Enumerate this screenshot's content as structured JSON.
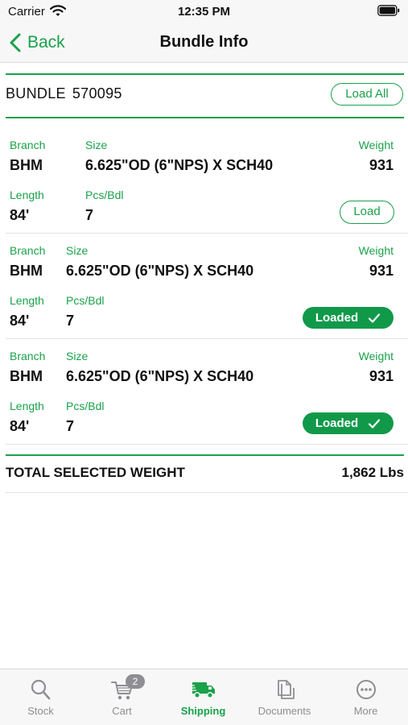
{
  "status_bar": {
    "carrier": "Carrier",
    "time": "12:35 PM"
  },
  "nav": {
    "back_label": "Back",
    "title": "Bundle Info"
  },
  "bundle": {
    "label": "BUNDLE",
    "number": "570095",
    "load_all_label": "Load All"
  },
  "labels": {
    "branch": "Branch",
    "size": "Size",
    "weight": "Weight",
    "length": "Length",
    "pcs_bdl": "Pcs/Bdl"
  },
  "items": [
    {
      "branch": "BHM",
      "size": "6.625\"OD (6\"NPS) X SCH40",
      "weight": "931",
      "length": "84'",
      "pcs_bdl": "7",
      "action_label": "Load",
      "state": "not-loaded"
    },
    {
      "branch": "BHM",
      "size": "6.625\"OD (6\"NPS) X SCH40",
      "weight": "931",
      "length": "84'",
      "pcs_bdl": "7",
      "action_label": "Loaded",
      "state": "loaded"
    },
    {
      "branch": "BHM",
      "size": "6.625\"OD (6\"NPS) X SCH40",
      "weight": "931",
      "length": "84'",
      "pcs_bdl": "7",
      "action_label": "Loaded",
      "state": "loaded"
    }
  ],
  "total": {
    "label": "TOTAL SELECTED WEIGHT",
    "value": "1,862 Lbs"
  },
  "tabs": [
    {
      "label": "Stock",
      "icon": "search-icon",
      "active": false
    },
    {
      "label": "Cart",
      "icon": "cart-icon",
      "active": false,
      "badge": "2"
    },
    {
      "label": "Shipping",
      "icon": "truck-icon",
      "active": true
    },
    {
      "label": "Documents",
      "icon": "documents-icon",
      "active": false
    },
    {
      "label": "More",
      "icon": "more-icon",
      "active": false
    }
  ],
  "colors": {
    "accent": "#1aa14a",
    "loaded_fill": "#11994a",
    "inactive_tab": "#8e8e93"
  }
}
